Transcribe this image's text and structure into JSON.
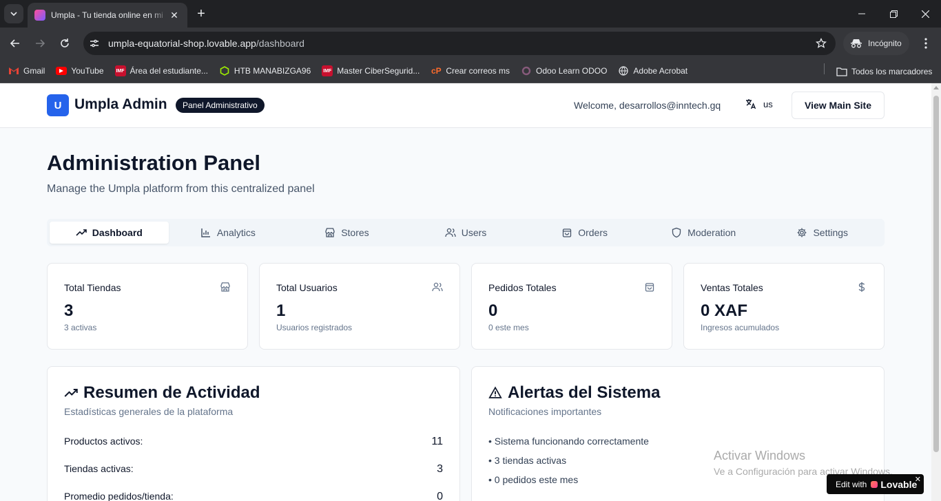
{
  "browser": {
    "tab_title": "Umpla - Tu tienda online en mi",
    "url_host": "umpla-equatorial-shop.lovable.app",
    "url_path": "/dashboard",
    "incognito_label": "Incógnito",
    "bookmarks": [
      {
        "label": "Gmail",
        "icon": "gmail-icon"
      },
      {
        "label": "YouTube",
        "icon": "youtube-icon"
      },
      {
        "label": "Área del estudiante...",
        "icon": "imf-icon"
      },
      {
        "label": "HTB MANABIZGA96",
        "icon": "htb-icon"
      },
      {
        "label": "Master CiberSegurid...",
        "icon": "imf-icon"
      },
      {
        "label": "Crear correos ms",
        "icon": "cpanel-icon"
      },
      {
        "label": "Odoo Learn ODOO",
        "icon": "odoo-icon"
      },
      {
        "label": "Adobe Acrobat",
        "icon": "globe-icon"
      }
    ],
    "all_bookmarks_label": "Todos los marcadores"
  },
  "header": {
    "logo_letter": "U",
    "brand": "Umpla Admin",
    "badge": "Panel Administrativo",
    "welcome": "Welcome, desarrollos@inntech.gq",
    "language": "us",
    "view_site": "View Main Site"
  },
  "page": {
    "title": "Administration Panel",
    "subtitle": "Manage the Umpla platform from this centralized panel"
  },
  "tabs": [
    {
      "label": "Dashboard",
      "icon": "trending-up-icon",
      "active": true
    },
    {
      "label": "Analytics",
      "icon": "bar-chart-icon",
      "active": false
    },
    {
      "label": "Stores",
      "icon": "store-icon",
      "active": false
    },
    {
      "label": "Users",
      "icon": "users-icon",
      "active": false
    },
    {
      "label": "Orders",
      "icon": "shopping-bag-icon",
      "active": false
    },
    {
      "label": "Moderation",
      "icon": "shield-icon",
      "active": false
    },
    {
      "label": "Settings",
      "icon": "gear-icon",
      "active": false
    }
  ],
  "stats": [
    {
      "label": "Total Tiendas",
      "value": "3",
      "note": "3 activas",
      "icon": "store-icon"
    },
    {
      "label": "Total Usuarios",
      "value": "1",
      "note": "Usuarios registrados",
      "icon": "users-icon"
    },
    {
      "label": "Pedidos Totales",
      "value": "0",
      "note": "0 este mes",
      "icon": "shopping-bag-icon"
    },
    {
      "label": "Ventas Totales",
      "value": "0 XAF",
      "note": "Ingresos acumulados",
      "icon": "dollar-icon"
    }
  ],
  "activity": {
    "title": "Resumen de Actividad",
    "subtitle": "Estadísticas generales de la plataforma",
    "rows": [
      {
        "label": "Productos activos:",
        "value": "11"
      },
      {
        "label": "Tiendas activas:",
        "value": "3"
      },
      {
        "label": "Promedio pedidos/tienda:",
        "value": "0"
      }
    ]
  },
  "alerts": {
    "title": "Alertas del Sistema",
    "subtitle": "Notificaciones importantes",
    "items": [
      "• Sistema funcionando correctamente",
      "• 3 tiendas activas",
      "• 0 pedidos este mes"
    ]
  },
  "watermark": {
    "line1": "Activar Windows",
    "line2": "Ve a Configuración para activar Windows."
  },
  "lovable_badge": {
    "prefix": "Edit with",
    "brand": "Lovable"
  },
  "colors": {
    "accent": "#2563eb",
    "page_bg": "#f8fafc",
    "text": "#0f172a",
    "muted": "#64748b"
  }
}
